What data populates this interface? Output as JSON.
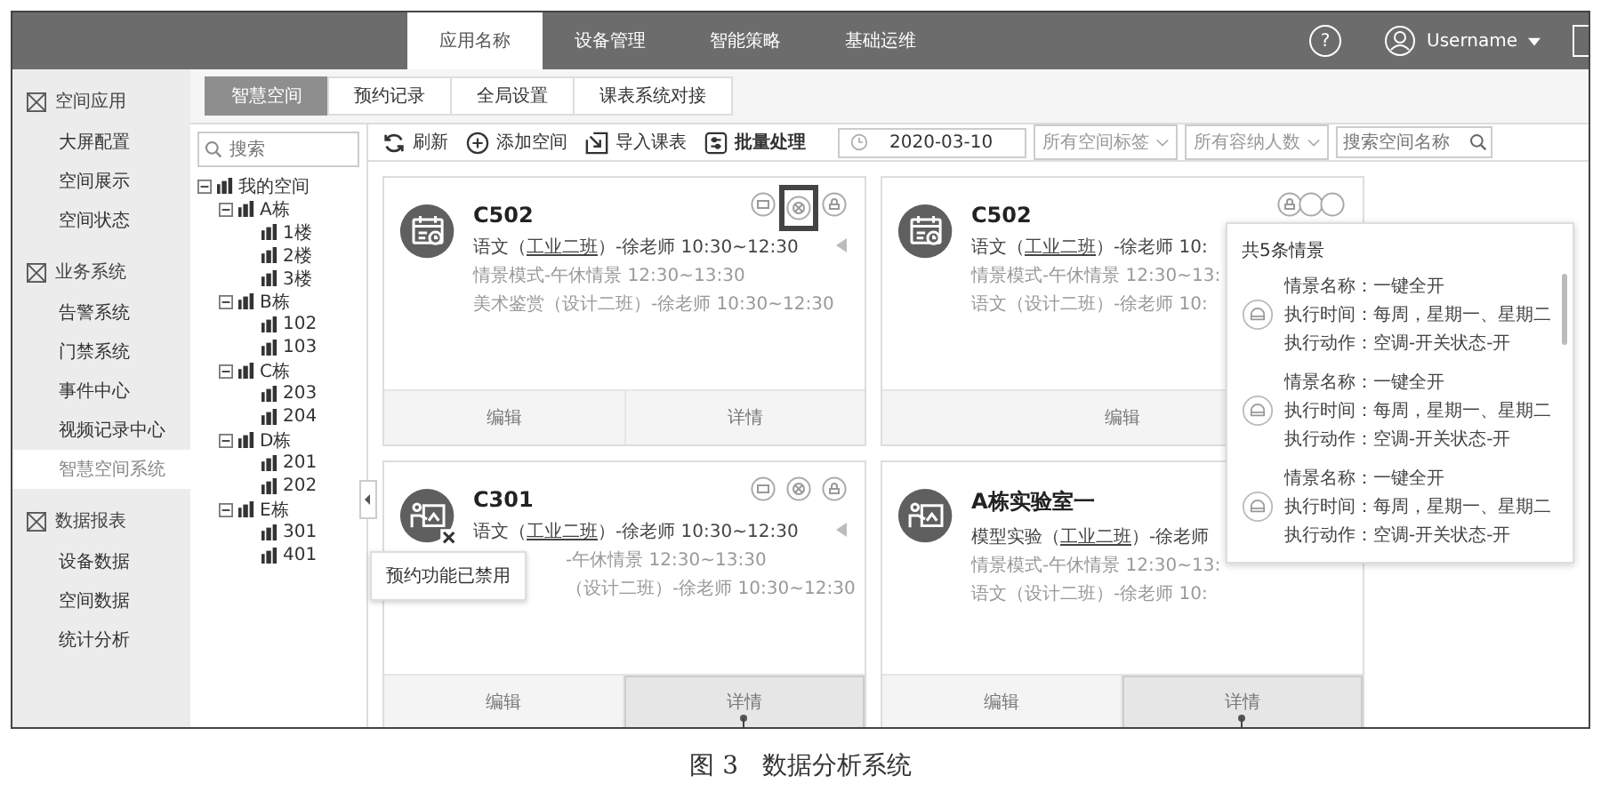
{
  "topbar": {
    "tabs": [
      {
        "label": "应用名称",
        "selected": true
      },
      {
        "label": "设备管理",
        "selected": false
      },
      {
        "label": "智能策略",
        "selected": false
      },
      {
        "label": "基础运维",
        "selected": false
      }
    ],
    "help": "?",
    "username": "Username"
  },
  "sidebar": {
    "sections": [
      {
        "title": "空间应用",
        "items": [
          {
            "label": "大屏配置",
            "selected": false
          },
          {
            "label": "空间展示",
            "selected": false
          },
          {
            "label": "空间状态",
            "selected": false
          }
        ]
      },
      {
        "title": "业务系统",
        "items": [
          {
            "label": "告警系统",
            "selected": false
          },
          {
            "label": "门禁系统",
            "selected": false
          },
          {
            "label": "事件中心",
            "selected": false
          },
          {
            "label": "视频记录中心",
            "selected": false
          },
          {
            "label": "智慧空间系统",
            "selected": true
          }
        ]
      },
      {
        "title": "数据报表",
        "items": [
          {
            "label": "设备数据",
            "selected": false
          },
          {
            "label": "空间数据",
            "selected": false
          },
          {
            "label": "统计分析",
            "selected": false
          }
        ]
      }
    ]
  },
  "tabs": [
    {
      "label": "智慧空间",
      "selected": true
    },
    {
      "label": "预约记录",
      "selected": false
    },
    {
      "label": "全局设置",
      "selected": false
    },
    {
      "label": "课表系统对接",
      "selected": false
    }
  ],
  "tree_search": {
    "placeholder": "搜索"
  },
  "tree": [
    {
      "label": "我的空间",
      "expanded": true,
      "children": [
        {
          "label": "A栋",
          "expanded": true,
          "children": [
            {
              "label": "1楼"
            },
            {
              "label": "2楼"
            },
            {
              "label": "3楼"
            }
          ]
        },
        {
          "label": "B栋",
          "expanded": true,
          "children": [
            {
              "label": "102"
            },
            {
              "label": "103"
            }
          ]
        },
        {
          "label": "C栋",
          "expanded": true,
          "children": [
            {
              "label": "203"
            },
            {
              "label": "204"
            }
          ]
        },
        {
          "label": "D栋",
          "expanded": true,
          "children": [
            {
              "label": "201"
            },
            {
              "label": "202"
            }
          ]
        },
        {
          "label": "E栋",
          "expanded": true,
          "children": [
            {
              "label": "301"
            },
            {
              "label": "401"
            }
          ]
        }
      ]
    }
  ],
  "toolbar": {
    "actions": [
      {
        "kind": "refresh",
        "label": "刷新"
      },
      {
        "kind": "add",
        "label": "添加空间"
      },
      {
        "kind": "import",
        "label": "导入课表"
      },
      {
        "kind": "batch",
        "label": "批量处理"
      }
    ],
    "date": "2020-03-10",
    "filters": [
      "所有空间标签",
      "所有容纳人数"
    ],
    "search_placeholder": "搜索空间名称"
  },
  "cards": [
    {
      "kind": "calendar",
      "icon_disabled": false,
      "title": "C502",
      "stacked": false,
      "caret": true,
      "icons": [
        {
          "kind": "projector",
          "highlight": false
        },
        {
          "kind": "fan",
          "highlight": true
        },
        {
          "kind": "lock",
          "highlight": false
        }
      ],
      "lines": [
        {
          "before": "语文（",
          "underlined": "工业二班",
          "after": "）-徐老师 10:30~12:30"
        },
        {
          "before": "情景模式-午休情景 12:30~13:30"
        },
        {
          "before": "美术鉴赏（设计二班）-徐老师 10:30~12:30"
        }
      ],
      "buttons": [
        {
          "label": "编辑",
          "pressed": false,
          "callout": false
        },
        {
          "label": "详情",
          "pressed": false,
          "callout": false
        }
      ]
    },
    {
      "kind": "calendar",
      "icon_disabled": false,
      "title": "C502",
      "stacked": true,
      "icons": [
        {
          "kind": "lock",
          "highlight": false
        },
        {
          "kind": "blank",
          "highlight": false
        },
        {
          "kind": "blank",
          "highlight": false
        }
      ],
      "lines": [
        {
          "before": "语文（",
          "underlined": "工业二班",
          "after": "）-徐老师 10:"
        },
        {
          "before": "情景模式-午休情景 12:30~13:"
        },
        {
          "before": "语文（设计二班）-徐老师 10:"
        }
      ],
      "buttons": [
        {
          "label": "编辑",
          "pressed": false,
          "callout": false
        }
      ]
    },
    {
      "kind": "board",
      "icon_disabled": true,
      "title": "C301",
      "stacked": false,
      "caret": true,
      "tooltip": "预约功能已禁用",
      "icons": [
        {
          "kind": "projector",
          "highlight": false
        },
        {
          "kind": "fan",
          "highlight": false
        },
        {
          "kind": "lock",
          "highlight": false
        }
      ],
      "lines": [
        {
          "before": "语文（",
          "underlined": "工业二班",
          "after": "）-徐老师 10:30~12:30"
        },
        {
          "before": "-午休情景 12:30~13:30"
        },
        {
          "before": "（设计二班）-徐老师 10:30~12:30"
        }
      ],
      "buttons": [
        {
          "label": "编辑",
          "pressed": false,
          "callout": false
        },
        {
          "label": "详情",
          "pressed": true,
          "callout": true
        }
      ]
    },
    {
      "kind": "board",
      "icon_disabled": false,
      "title": "A栋实验室一",
      "lines": [
        {
          "before": "模型实验（",
          "underlined": "工业二班",
          "after": "）-徐老师"
        },
        {
          "before": "情景模式-午休情景 12:30~13:"
        },
        {
          "before": "语文（设计二班）-徐老师 10:"
        }
      ],
      "buttons": [
        {
          "label": "编辑",
          "pressed": false,
          "callout": false
        },
        {
          "label": "详情",
          "pressed": true,
          "callout": true
        }
      ]
    }
  ],
  "popover": {
    "title": "共5条情景",
    "entries": [
      {
        "lines": [
          "情景名称：一键全开",
          "执行时间：每周，星期一、星期二",
          "执行动作：空调-开关状态-开"
        ]
      },
      {
        "lines": [
          "情景名称：一键全开",
          "执行时间：每周，星期一、星期二",
          "执行动作：空调-开关状态-开"
        ]
      },
      {
        "lines": [
          "情景名称：一键全开",
          "执行时间：每周，星期一、星期二",
          "执行动作：空调-开关状态-开"
        ]
      }
    ]
  },
  "caption": "图 3   数据分析系统"
}
